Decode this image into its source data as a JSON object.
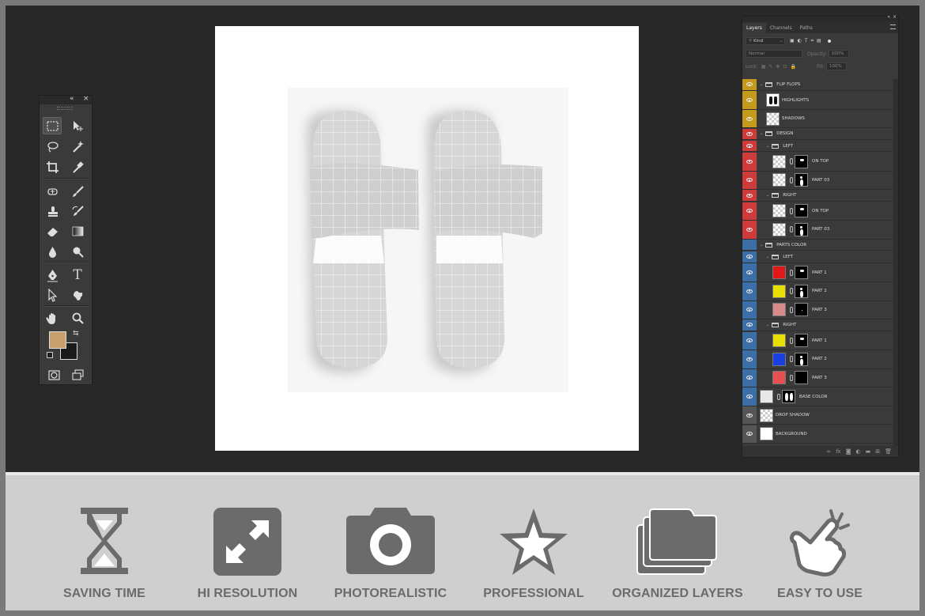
{
  "layers_panel": {
    "tabs": [
      "Layers",
      "Channels",
      "Paths"
    ],
    "filter_kind": "Kind",
    "blend_mode": "Normal",
    "opacity_label": "Opacity:",
    "opacity_value": "100%",
    "lock_label": "Lock:",
    "fill_label": "Fill:",
    "fill_value": "100%",
    "rows": [
      {
        "name": "FLIP FLOPS",
        "type": "group",
        "indent": 0,
        "tag": "#c59a1a"
      },
      {
        "name": "HIGHLIGHTS",
        "type": "layer",
        "indent": 1,
        "tag": "#c59a1a",
        "thumb": "sandals"
      },
      {
        "name": "SHADOWS",
        "type": "layer",
        "indent": 1,
        "tag": "#c59a1a",
        "thumb": "checker"
      },
      {
        "name": "DESIGN",
        "type": "group",
        "indent": 0,
        "tag": "#cf3b3b"
      },
      {
        "name": "LEFT",
        "type": "group",
        "indent": 1,
        "tag": "#cf3b3b"
      },
      {
        "name": "ON TOP",
        "type": "layer",
        "indent": 2,
        "tag": "#cf3b3b",
        "thumb": "checker",
        "mask": "top"
      },
      {
        "name": "PART 03",
        "type": "layer",
        "indent": 2,
        "tag": "#cf3b3b",
        "thumb": "checker",
        "mask": "sole"
      },
      {
        "name": "RIGHT",
        "type": "group",
        "indent": 1,
        "tag": "#cf3b3b"
      },
      {
        "name": "ON TOP",
        "type": "layer",
        "indent": 2,
        "tag": "#cf3b3b",
        "thumb": "checker",
        "mask": "top"
      },
      {
        "name": "PART 03",
        "type": "layer",
        "indent": 2,
        "tag": "#cf3b3b",
        "thumb": "checker",
        "mask": "sole"
      },
      {
        "name": "PARTS COLOR",
        "type": "group",
        "indent": 0,
        "tag": "#3c6ea8",
        "hidden": true
      },
      {
        "name": "LEFT",
        "type": "group",
        "indent": 1,
        "tag": "#3c6ea8"
      },
      {
        "name": "PART 1",
        "type": "layer",
        "indent": 2,
        "tag": "#3c6ea8",
        "color": "#e01818",
        "mask": "top"
      },
      {
        "name": "PART 2",
        "type": "layer",
        "indent": 2,
        "tag": "#3c6ea8",
        "color": "#e8e000",
        "mask": "sole"
      },
      {
        "name": "PART 3",
        "type": "layer",
        "indent": 2,
        "tag": "#3c6ea8",
        "color": "#d98a8a",
        "mask": "dot"
      },
      {
        "name": "RIGHT",
        "type": "group",
        "indent": 1,
        "tag": "#3c6ea8"
      },
      {
        "name": "PART 1",
        "type": "layer",
        "indent": 2,
        "tag": "#3c6ea8",
        "color": "#e8e000",
        "mask": "top"
      },
      {
        "name": "PART 2",
        "type": "layer",
        "indent": 2,
        "tag": "#3c6ea8",
        "color": "#1a3fe0",
        "mask": "sole"
      },
      {
        "name": "PART 3",
        "type": "layer",
        "indent": 2,
        "tag": "#3c6ea8",
        "color": "#e85050",
        "mask": "none"
      },
      {
        "name": "BASE COLOR",
        "type": "layer",
        "indent": 0,
        "tag": "#3c6ea8",
        "color": "#e8e8e8",
        "mask": "sandals"
      },
      {
        "name": "DROP SHADOW",
        "type": "layer",
        "indent": 0,
        "tag": "#555555",
        "thumb": "checker"
      },
      {
        "name": "BACKGROUND",
        "type": "layer",
        "indent": 0,
        "tag": "#555555",
        "color": "#ffffff"
      }
    ]
  },
  "toolbox": {
    "foreground_color": "#c8a06e",
    "background_color": "#1a1a1a"
  },
  "features": [
    {
      "label": "SAVING TIME",
      "icon": "hourglass-icon"
    },
    {
      "label": "HI RESOLUTION",
      "icon": "expand-arrows-icon"
    },
    {
      "label": "PHOTOREALISTIC",
      "icon": "camera-icon"
    },
    {
      "label": "PROFESSIONAL",
      "icon": "star-icon"
    },
    {
      "label": "ORGANIZED LAYERS",
      "icon": "folders-icon"
    },
    {
      "label": "EASY TO USE",
      "icon": "pointing-hand-icon"
    }
  ]
}
